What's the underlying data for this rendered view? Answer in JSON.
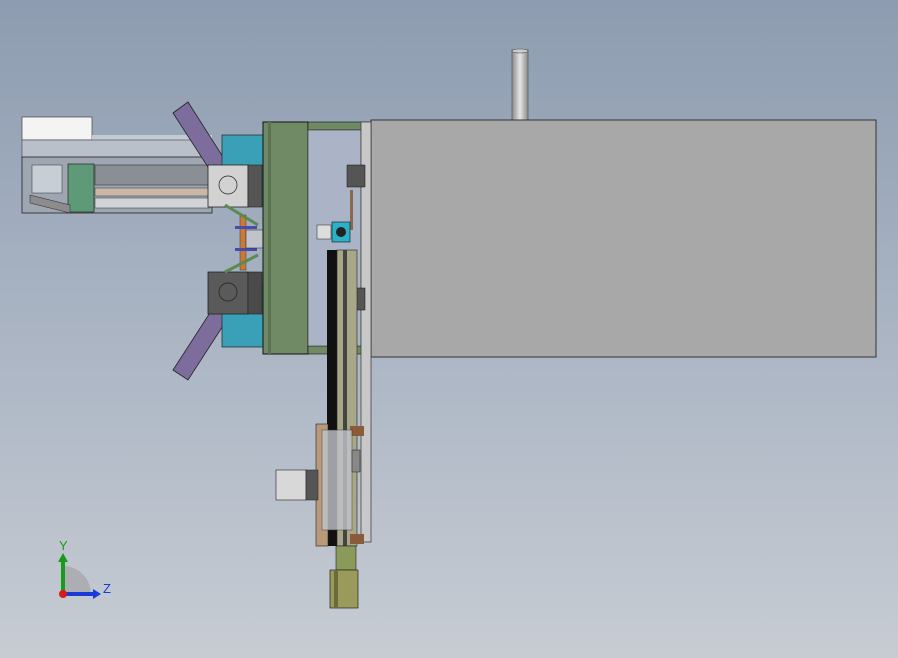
{
  "viewport": {
    "type": "cad-3d-view"
  },
  "triad": {
    "y_label": "Y",
    "z_label": "Z",
    "y_color": "#1a9a1a",
    "z_color": "#1a3ad8",
    "x_color": "#d81a1a"
  },
  "colors": {
    "plate": "#6f8a64",
    "housing": "#a8a8a8",
    "blade": "#7c6d9c",
    "bracket": "#3aa0b8",
    "panel": "#aab4c6"
  }
}
